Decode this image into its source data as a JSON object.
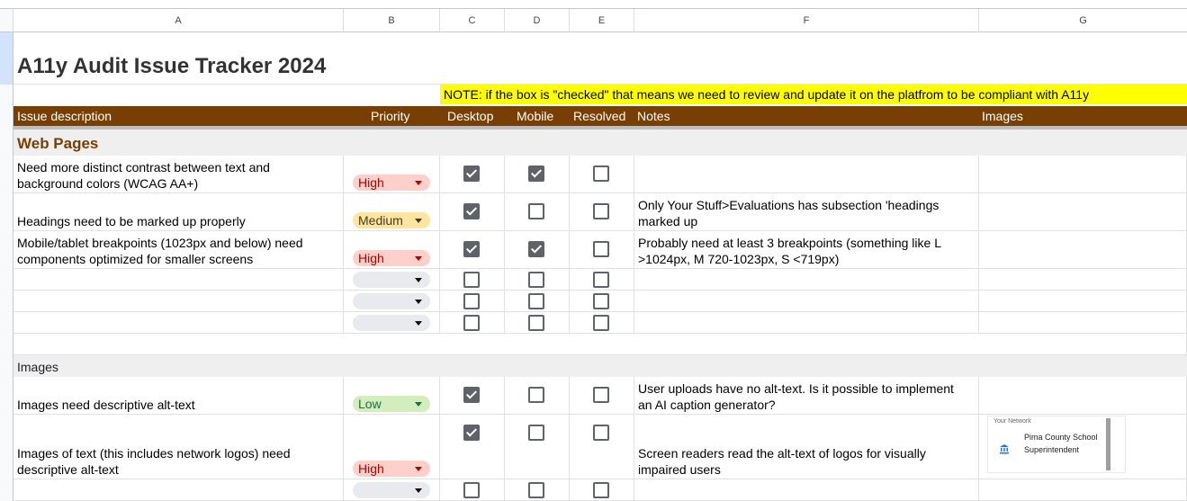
{
  "columns": [
    "A",
    "B",
    "C",
    "D",
    "E",
    "F",
    "G"
  ],
  "title": "A11y Audit Issue Tracker 2024",
  "note": "NOTE: if the box is \"checked\" that means we need to review and update it on the platfrom to be compliant with A11y",
  "headers": {
    "issue": "Issue description",
    "priority": "Priority",
    "desktop": "Desktop",
    "mobile": "Mobile",
    "resolved": "Resolved",
    "notes": "Notes",
    "images": "Images"
  },
  "sections": {
    "web": "Web Pages",
    "images": "Images"
  },
  "rows": [
    {
      "issue": "Need more distinct contrast between text and background colors (WCAG AA+)",
      "priority": "High",
      "desktop": true,
      "mobile": true,
      "resolved": false,
      "notes": ""
    },
    {
      "issue": "Headings need to be marked up properly",
      "priority": "Medium",
      "desktop": true,
      "mobile": false,
      "resolved": false,
      "notes": "Only Your Stuff>Evaluations has subsection 'headings marked up"
    },
    {
      "issue": "Mobile/tablet breakpoints (1023px and below) need components optimized for smaller screens",
      "priority": "High",
      "desktop": true,
      "mobile": true,
      "resolved": false,
      "notes": "Probably need at least 3 breakpoints (something like L >1024px, M 720-1023px, S <719px)"
    },
    {
      "issue": "",
      "priority": "",
      "desktop": false,
      "mobile": false,
      "resolved": false,
      "notes": ""
    },
    {
      "issue": "",
      "priority": "",
      "desktop": false,
      "mobile": false,
      "resolved": false,
      "notes": ""
    },
    {
      "issue": "",
      "priority": "",
      "desktop": false,
      "mobile": false,
      "resolved": false,
      "notes": ""
    },
    {
      "issue": "Images need descriptive alt-text",
      "priority": "Low",
      "desktop": true,
      "mobile": false,
      "resolved": false,
      "notes": "User uploads have no alt-text. Is it possible to implement an AI caption generator?"
    },
    {
      "issue": "Images of text (this includes network logos) need descriptive alt-text",
      "priority": "High",
      "desktop": true,
      "mobile": false,
      "resolved": false,
      "notes": "Screen readers read the alt-text of logos for visually impaired users"
    },
    {
      "issue": "",
      "priority": "",
      "desktop": false,
      "mobile": false,
      "resolved": false,
      "notes": ""
    }
  ],
  "priority_colors": {
    "High": {
      "bg": "#ffcfc9",
      "fg": "#b10202"
    },
    "Medium": {
      "bg": "#ffe5a0",
      "fg": "#473821"
    },
    "Low": {
      "bg": "#d4edbc",
      "fg": "#11734b"
    },
    "": {
      "bg": "#e8eaed",
      "fg": "#333333"
    }
  },
  "thumbnail": {
    "network_label": "Your Network",
    "org_name": "Pima County School Superintendent",
    "icon": "courthouse-icon"
  }
}
